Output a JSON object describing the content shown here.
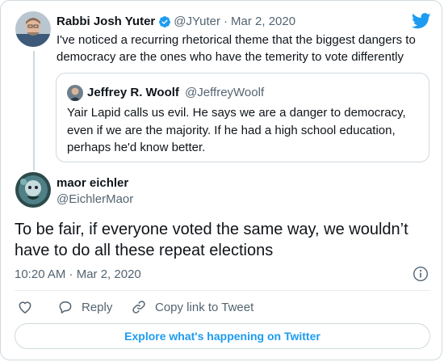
{
  "main_tweet": {
    "author_name": "Rabbi Josh Yuter",
    "handle": "@JYuter",
    "separator": "·",
    "date": "Mar 2, 2020",
    "text_line1": "I've noticed a recurring rhetorical theme that the biggest dangers to",
    "text_line2": "democracy are the ones who have the temerity to vote differently"
  },
  "quoted_tweet": {
    "author_name": "Jeffrey R. Woolf",
    "handle": "@JeffreyWoolf",
    "text_line1": "Yair Lapid calls us evil. He says we are a danger to democracy,",
    "text_line2": "even if we are the majority. If he had a high school education,",
    "text_line3": "perhaps he'd know better."
  },
  "reply_tweet": {
    "author_name": "maor eichler",
    "handle": "@EichlerMaor",
    "text_line1": "To be fair, if everyone voted the same way, we wouldn’t",
    "text_line2": "have to do all these repeat elections",
    "timestamp": "10:20 AM · Mar 2, 2020"
  },
  "actions": {
    "reply_label": "Reply",
    "copy_link_label": "Copy link to Tweet"
  },
  "cta": {
    "label": "Explore what's happening on Twitter"
  },
  "colors": {
    "twitter_blue": "#1d9bf0",
    "verified_blue": "#1d9bf0",
    "muted": "#536471",
    "border": "#cfd9de"
  },
  "icons": [
    "twitter-bird-icon",
    "verified-badge-icon",
    "info-icon",
    "heart-icon",
    "reply-icon",
    "link-icon"
  ]
}
